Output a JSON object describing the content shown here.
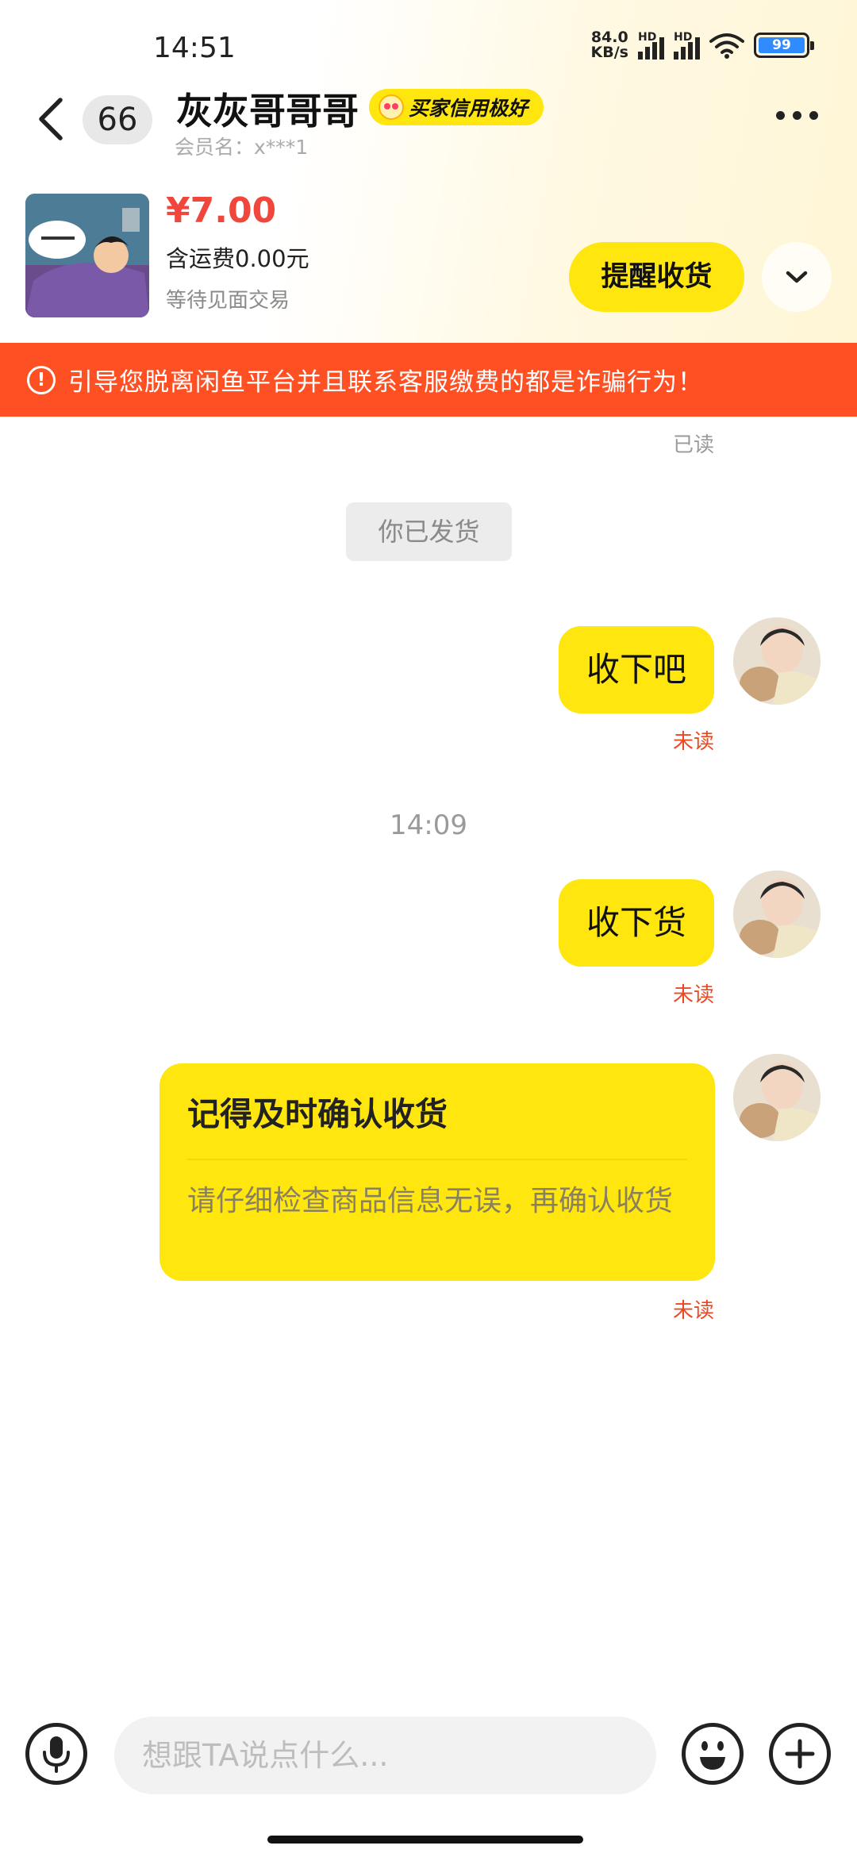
{
  "status_bar": {
    "time": "14:51",
    "net_speed_value": "84.0",
    "net_speed_unit": "KB/s",
    "signal_label": "HD",
    "battery": "99"
  },
  "header": {
    "unread_count": "66",
    "contact_name": "灰灰哥哥哥",
    "credit_badge": "买家信用极好",
    "member_name": "会员名：x***1"
  },
  "product": {
    "price": "¥7.00",
    "shipping": "含运费0.00元",
    "status": "等待见面交易",
    "remind_button": "提醒收货"
  },
  "warning": {
    "text": "引导您脱离闲鱼平台并且联系客服缴费的都是诈骗行为！"
  },
  "chat": {
    "read_status": "已读",
    "system_message": "你已发货",
    "messages": [
      {
        "text": "收下吧",
        "status": "未读"
      },
      {
        "text": "收下货",
        "status": "未读"
      }
    ],
    "timestamp": "14:09",
    "card": {
      "title": "记得及时确认收货",
      "desc": "请仔细检查商品信息无误，再确认收货",
      "status": "未读"
    }
  },
  "input": {
    "placeholder": "想跟TA说点什么..."
  },
  "colors": {
    "accent_yellow": "#ffe60f",
    "warning_orange": "#ff5023",
    "price_red": "#f1463c",
    "unread_red": "#e94a24"
  }
}
